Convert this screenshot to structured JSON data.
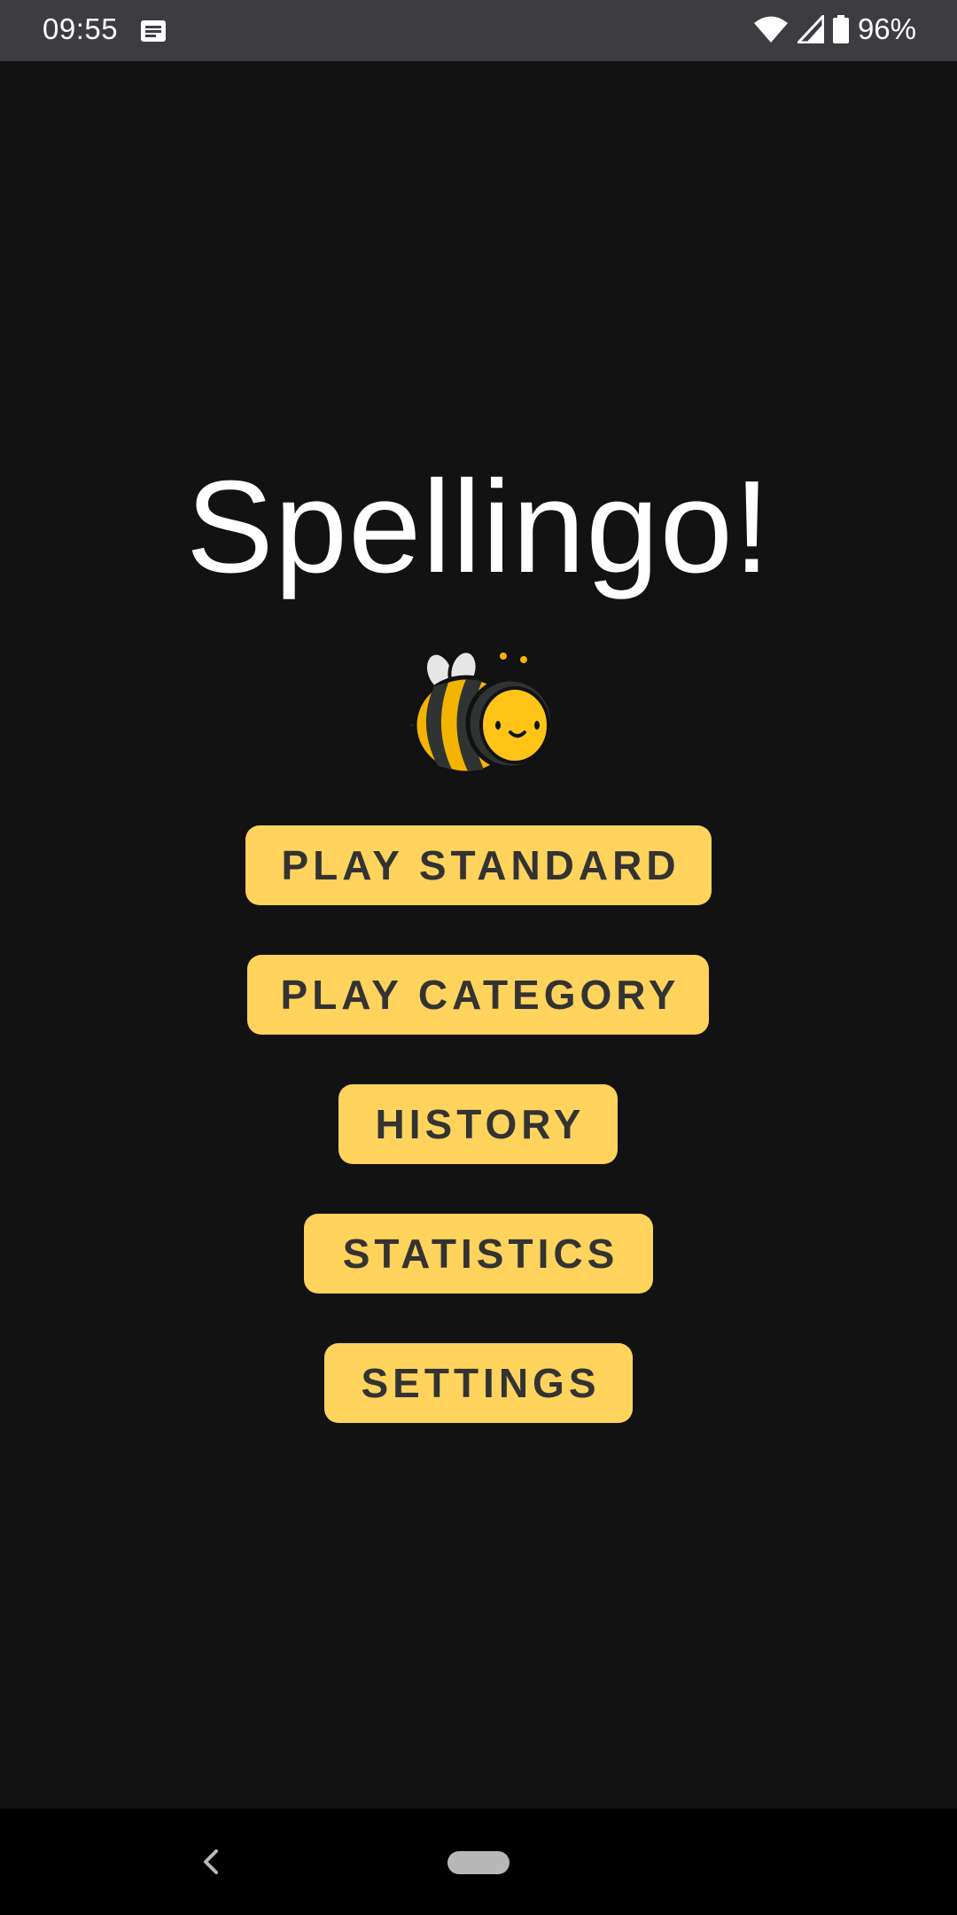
{
  "status_bar": {
    "time": "09:55",
    "battery": "96%",
    "icons": [
      "message-icon",
      "wifi-icon",
      "signal-icon",
      "battery-icon"
    ]
  },
  "app": {
    "title": "Spellingo!",
    "logo": "bee-icon"
  },
  "menu": {
    "play_standard": "PLAY STANDARD",
    "play_category": "PLAY CATEGORY",
    "history": "HISTORY",
    "statistics": "STATISTICS",
    "settings": "SETTINGS"
  },
  "nav_bar": {
    "icons": [
      "back-icon",
      "home-pill-icon"
    ]
  },
  "colors": {
    "background": "#121212",
    "status_bar": "#3d3c40",
    "button": "#ffd35c",
    "button_text": "#333333",
    "title": "#ffffff"
  }
}
